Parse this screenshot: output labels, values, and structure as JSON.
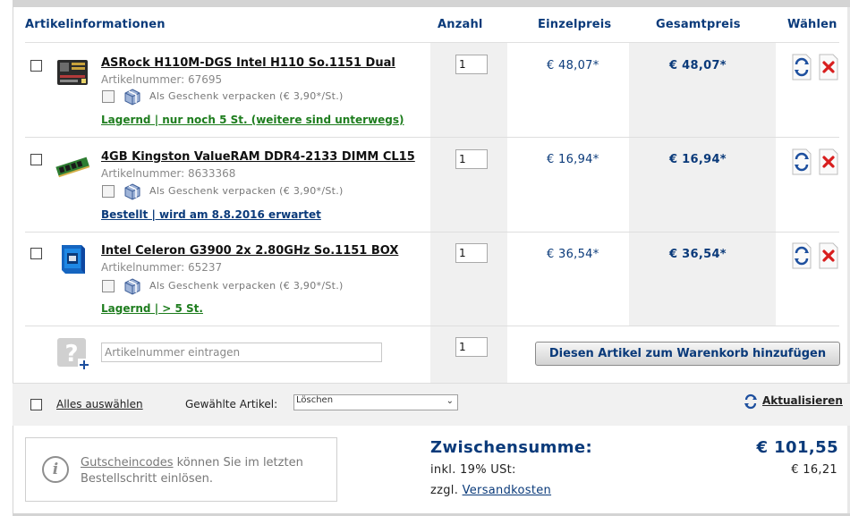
{
  "headers": {
    "info": "Artikelinformationen",
    "qty": "Anzahl",
    "unit": "Einzelpreis",
    "total": "Gesamtpreis",
    "select": "Wählen"
  },
  "items": [
    {
      "name": "ASRock H110M-DGS Intel H110 So.1151 Dual",
      "artnr": "Artikelnummer: 67695",
      "gift": "Als Geschenk verpacken (€ 3,90*/St.)",
      "stock": "Lagernd | nur noch 5 St. (weitere sind unterwegs)",
      "qty": "1",
      "unit": "€ 48,07*",
      "total": "€ 48,07*"
    },
    {
      "name": "4GB Kingston ValueRAM DDR4-2133 DIMM CL15",
      "artnr": "Artikelnummer: 8633368",
      "gift": "Als Geschenk verpacken (€ 3,90*/St.)",
      "stock": "Bestellt | wird am 8.8.2016 erwartet",
      "qty": "1",
      "unit": "€ 16,94*",
      "total": "€ 16,94*"
    },
    {
      "name": "Intel Celeron G3900 2x 2.80GHz So.1151 BOX",
      "artnr": "Artikelnummer: 65237",
      "gift": "Als Geschenk verpacken (€ 3,90*/St.)",
      "stock": "Lagernd | > 5 St.",
      "qty": "1",
      "unit": "€ 36,54*",
      "total": "€ 36,54*"
    }
  ],
  "add": {
    "placeholder": "Artikelnummer eintragen",
    "qty": "1",
    "button": "Diesen Artikel zum Warenkorb hinzufügen"
  },
  "footer": {
    "select_all": "Alles auswählen",
    "selected_label": "Gewählte Artikel:",
    "action_value": "Löschen",
    "refresh": "Aktualisieren"
  },
  "info": {
    "link": "Gutscheincodes",
    "text": " können Sie im letzten Bestellschritt einlösen."
  },
  "summary": {
    "subtotal_label": "Zwischensumme:",
    "subtotal_value": "€ 101,55",
    "vat_label": "inkl. 19% USt:",
    "vat_value": "€ 16,21",
    "shipping_prefix": "zzgl. ",
    "shipping_link": "Versandkosten"
  },
  "colors": {
    "accent": "#0a3a7a",
    "in_stock": "#1e7d1e",
    "delete": "#d81e1e"
  }
}
